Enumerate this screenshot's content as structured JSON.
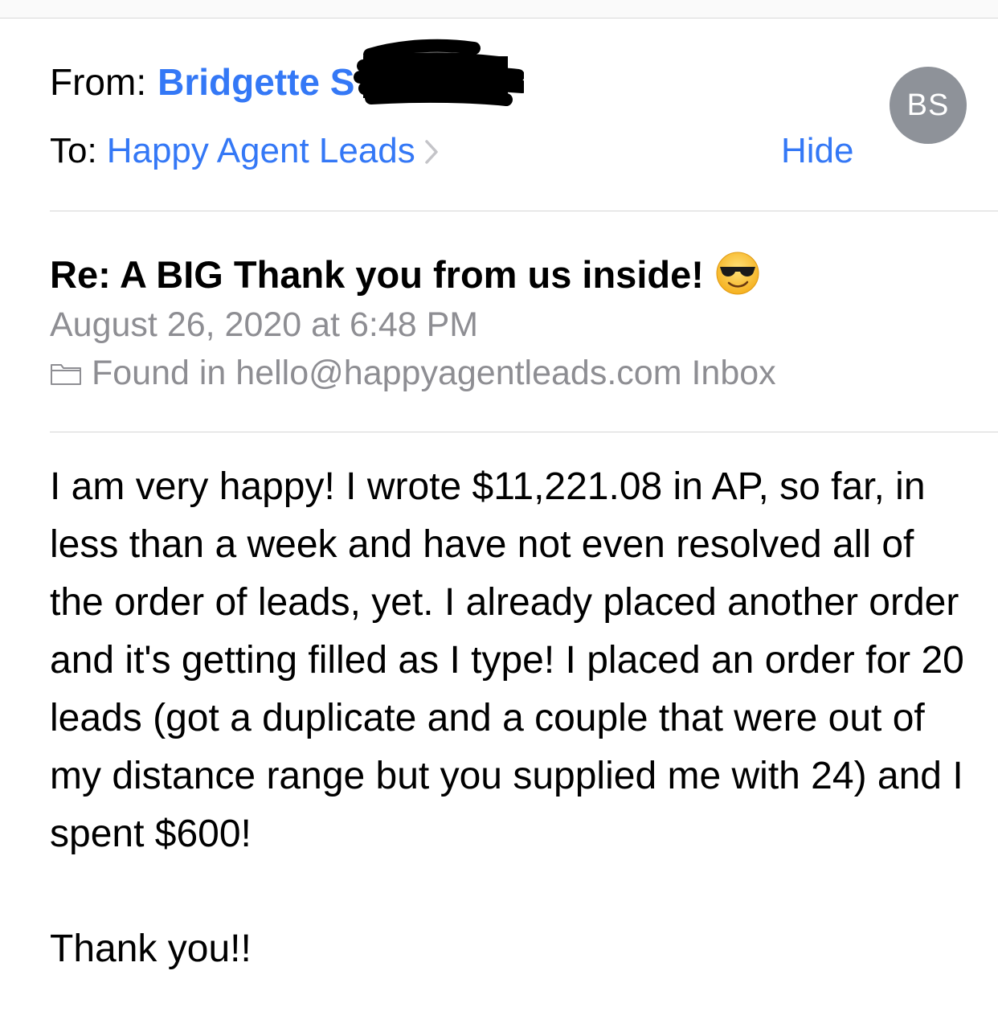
{
  "header": {
    "from_label": "From:",
    "sender_name": "Bridgette S",
    "to_label": "To:",
    "recipient": "Happy Agent Leads",
    "hide_label": "Hide",
    "avatar_initials": "BS"
  },
  "message": {
    "subject": "Re: A BIG Thank you from us inside!",
    "subject_emoji": "smiling-face-with-sunglasses",
    "date": "August 26, 2020 at 6:48 PM",
    "found_in": "Found in hello@happyagentleads.com Inbox",
    "body": "I am very happy!  I wrote $11,221.08 in AP, so far, in less than a week and have not even resolved all of the order of leads, yet.  I already placed another order and it's getting filled as I type!  I placed an order for 20 leads (got a duplicate and a couple that were out of my distance range but you supplied me with 24) and I spent $600!",
    "signoff": "Thank you!!"
  },
  "colors": {
    "link": "#3478f6",
    "secondary_text": "#8e8e93",
    "avatar_bg": "#8e9299"
  }
}
